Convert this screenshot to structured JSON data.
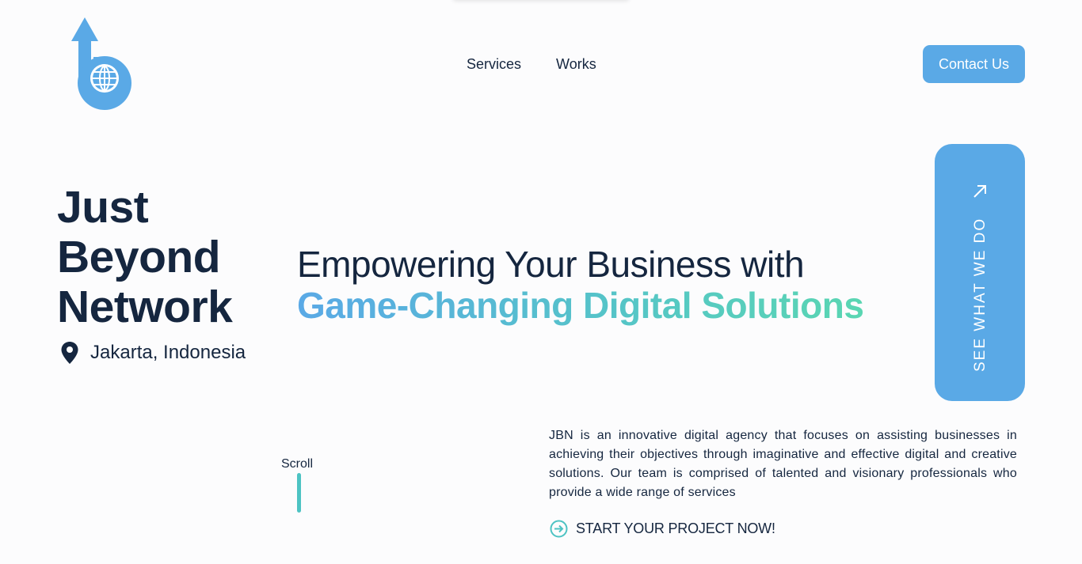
{
  "nav": {
    "items": [
      {
        "label": "Services"
      },
      {
        "label": "Works"
      }
    ],
    "contact_label": "Contact Us"
  },
  "hero": {
    "brand_lines": [
      "Just",
      "Beyond",
      "Network"
    ],
    "location": "Jakarta, Indonesia",
    "headline_line1": "Empowering Your Business with",
    "headline_line2": "Game-Changing Digital Solutions",
    "side_button_label": "SEE WHAT WE DO"
  },
  "scroll": {
    "label": "Scroll"
  },
  "about": {
    "description": "JBN is an innovative digital agency that focuses on assisting businesses in achieving their objectives through imaginative and effective digital and creative solutions. Our team is comprised of talented and visionary professionals who provide a wide range of services",
    "cta_label": "START YOUR PROJECT NOW!"
  },
  "icons": {
    "logo": "jbn-logo",
    "location": "map-pin-icon",
    "side_arrow": "arrow-up-right-icon",
    "cta": "circle-arrow-right-icon"
  },
  "colors": {
    "primary": "#5aa9e6",
    "dark": "#15263f",
    "teal": "#4dc3c3",
    "gradient_end": "#5ad6b2"
  }
}
